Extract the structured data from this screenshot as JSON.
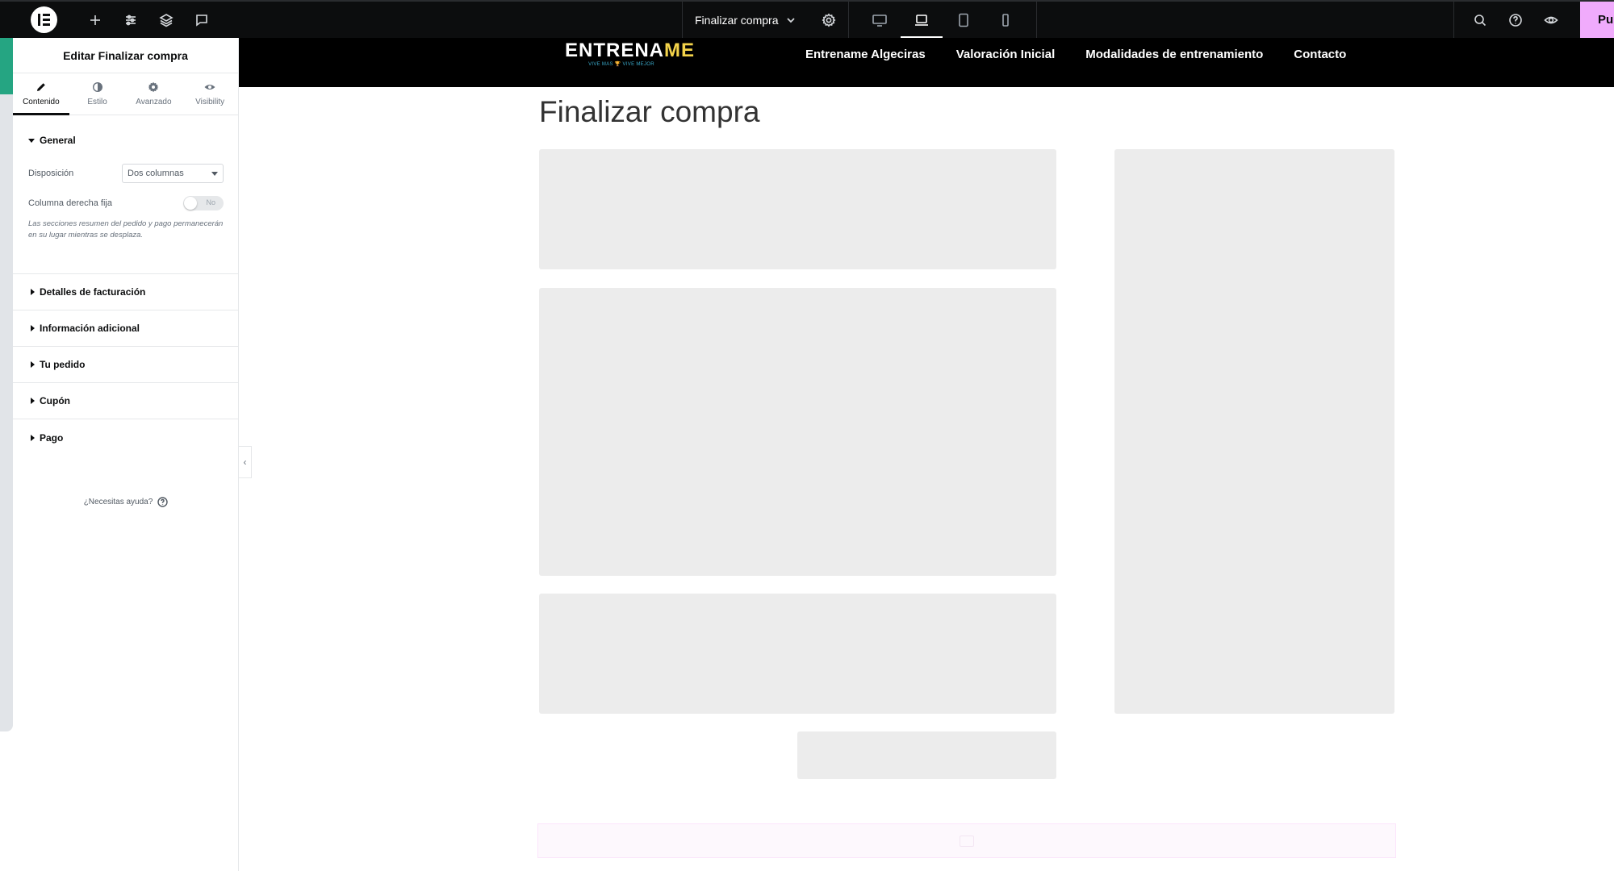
{
  "topbar": {
    "page_name": "Finalizar compra",
    "publish_label": "Pu",
    "left_icons": [
      "elementor-logo-icon",
      "plus-icon",
      "sliders-icon",
      "layers-icon",
      "comment-icon"
    ],
    "devices": [
      "desktop-icon",
      "laptop-icon",
      "tablet-icon",
      "mobile-icon"
    ],
    "active_device": "laptop-icon",
    "right_icons": [
      "search-icon",
      "help-circle-icon",
      "eye-icon"
    ],
    "publish_color": "#f0abfc"
  },
  "panel": {
    "title": "Editar Finalizar compra",
    "tabs": [
      {
        "label": "Contenido",
        "icon": "pencil-icon"
      },
      {
        "label": "Estilo",
        "icon": "contrast-icon"
      },
      {
        "label": "Avanzado",
        "icon": "gear-icon"
      },
      {
        "label": "Visibility",
        "icon": "eye-icon"
      }
    ],
    "general": {
      "title": "General",
      "layout_label": "Disposición",
      "layout_value": "Dos columnas",
      "sticky_label": "Columna derecha fija",
      "sticky_value": "No",
      "note": "Las secciones resumen del pedido y pago permanecerán en su lugar mientras se desplaza."
    },
    "sections": [
      "Detalles de facturación",
      "Información adicional",
      "Tu pedido",
      "Cupón",
      "Pago"
    ],
    "help": "¿Necesitas ayuda?"
  },
  "site": {
    "logo_main": "ENTRENA",
    "logo_accent": "ME",
    "logo_tagline": "VIVE MAS 🏆 VIVE MEJOR",
    "nav": [
      "Entrename Algeciras",
      "Valoración Inicial",
      "Modalidades de entrenamiento",
      "Contacto"
    ],
    "page_title": "Finalizar compra",
    "accent_color": "#f3d34a"
  }
}
